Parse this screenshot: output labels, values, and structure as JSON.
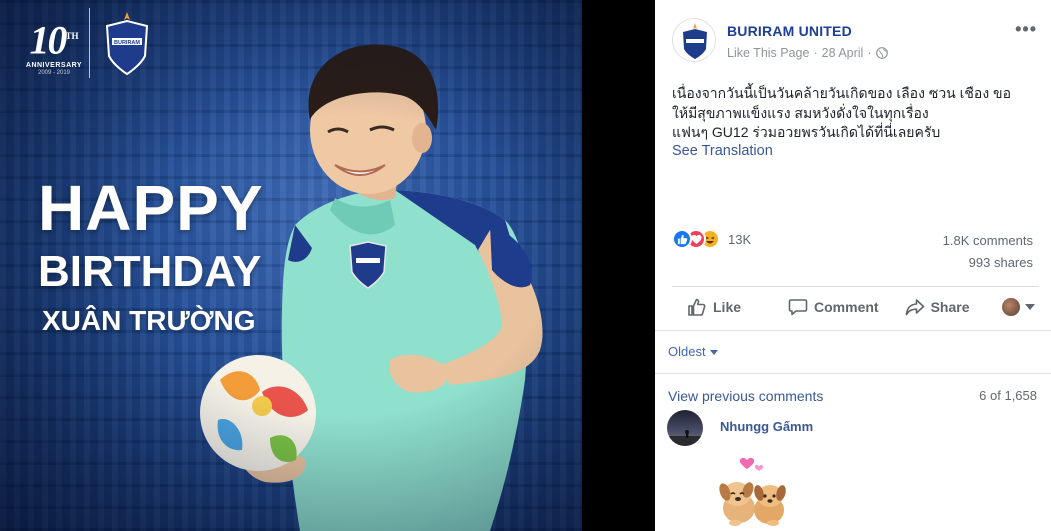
{
  "photo": {
    "anniversary": {
      "number": "10",
      "suffix": "TH",
      "label": "ANNIVERSARY",
      "years": "2009 - 2019"
    },
    "crest_text": "BURIRAM",
    "headline": {
      "line1": "HAPPY",
      "line2": "BIRTHDAY",
      "line3": "XUÂN TRƯỜNG"
    }
  },
  "post": {
    "page_name": "BURIRAM UNITED",
    "like_page": "Like This Page",
    "separator": "·",
    "date": "28 April",
    "more": "•••",
    "text_lines": [
      "เนื่องจากวันนี้เป็นวันคล้ายวันเกิดของ เลือง ซวน เชือง ขอ",
      "ให้มีสุขภาพแข็งแรง สมหวังดั่งใจในทุกเรื่อง",
      "แฟนๆ GU12 ร่วมอวยพรวันเกิดได้ที่นี่เลยครับ"
    ],
    "see_translation": "See Translation",
    "reactions_count": "13K",
    "comments_count": "1.8K comments",
    "shares_count": "993 shares",
    "actions": {
      "like": "Like",
      "comment": "Comment",
      "share": "Share"
    },
    "sort_label": "Oldest",
    "view_previous": "View previous comments",
    "comment_position": "6 of 1,658",
    "comment": {
      "author": "Nhungg Gấmm"
    }
  },
  "colors": {
    "brand_blue": "#1c3f94",
    "link_blue": "#385898",
    "like_blue": "#1877f2",
    "love_red": "#f33e58",
    "haha_yellow": "#f7b125"
  },
  "icons": [
    "globe-icon",
    "like-reaction-icon",
    "love-reaction-icon",
    "haha-reaction-icon",
    "thumbs-up-icon",
    "comment-icon",
    "share-icon",
    "caret-down-icon"
  ]
}
